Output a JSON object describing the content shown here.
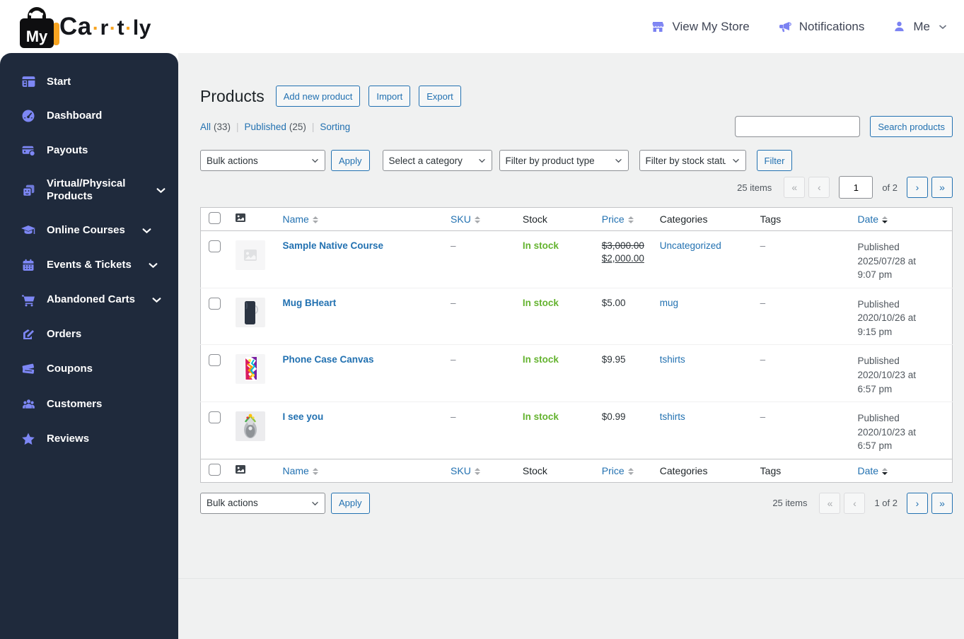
{
  "logo": {
    "my": "My",
    "ca": "Ca",
    "r": "r",
    "t": "t",
    "ly": "ly",
    "dot": "·"
  },
  "topnav": {
    "view_store": "View My Store",
    "notifications": "Notifications",
    "me": "Me"
  },
  "sidebar": {
    "items": [
      {
        "label": "Start"
      },
      {
        "label": "Dashboard"
      },
      {
        "label": "Payouts"
      },
      {
        "label": "Virtual/Physical Products"
      },
      {
        "label": "Online Courses"
      },
      {
        "label": "Events & Tickets"
      },
      {
        "label": "Abandoned Carts"
      },
      {
        "label": "Orders"
      },
      {
        "label": "Coupons"
      },
      {
        "label": "Customers"
      },
      {
        "label": "Reviews"
      }
    ]
  },
  "page": {
    "title": "Products",
    "actions": {
      "add": "Add new product",
      "import": "Import",
      "export": "Export"
    },
    "subnav": {
      "all": "All",
      "all_count": "(33)",
      "published": "Published",
      "published_count": "(25)",
      "sorting": "Sorting",
      "sep": "|"
    }
  },
  "search": {
    "button": "Search products",
    "value": ""
  },
  "filters": {
    "bulk_actions": "Bulk actions",
    "apply": "Apply",
    "category": "Select a category",
    "product_type": "Filter by product type",
    "stock_status": "Filter by stock status",
    "filter": "Filter"
  },
  "pagination": {
    "items_label": "25 items",
    "first": "«",
    "prev": "‹",
    "next": "›",
    "last": "»",
    "page": "1",
    "of_label": "of 2",
    "bottom_page_label": "1 of 2"
  },
  "table": {
    "headers": [
      "Name",
      "SKU",
      "Stock",
      "Price",
      "Categories",
      "Tags",
      "Date"
    ],
    "rows": [
      {
        "name": "Sample Native Course",
        "sku": "–",
        "stock": "In stock",
        "price_regular": "$3,000.00",
        "price_sale": "$2,000.00",
        "category": "Uncategorized",
        "tags": "–",
        "date_status": "Published",
        "date": "2025/07/28 at 9:07 pm"
      },
      {
        "name": "Mug BHeart",
        "sku": "–",
        "stock": "In stock",
        "price": "$5.00",
        "category": "mug",
        "tags": "–",
        "date_status": "Published",
        "date": "2020/10/26 at 9:15 pm"
      },
      {
        "name": "Phone Case Canvas",
        "sku": "–",
        "stock": "In stock",
        "price": "$9.95",
        "category": "tshirts",
        "tags": "–",
        "date_status": "Published",
        "date": "2020/10/23 at 6:57 pm"
      },
      {
        "name": "I see you",
        "sku": "–",
        "stock": "In stock",
        "price": "$0.99",
        "category": "tshirts",
        "tags": "–",
        "date_status": "Published",
        "date": "2020/10/23 at 6:57 pm"
      }
    ]
  },
  "colors": {
    "accent_blue": "#2271b1",
    "sidebar_bg": "#1f2a3c",
    "icon_indigo": "#7d87f5",
    "instock_green": "#64b32f",
    "brand_orange": "#f7a421"
  }
}
